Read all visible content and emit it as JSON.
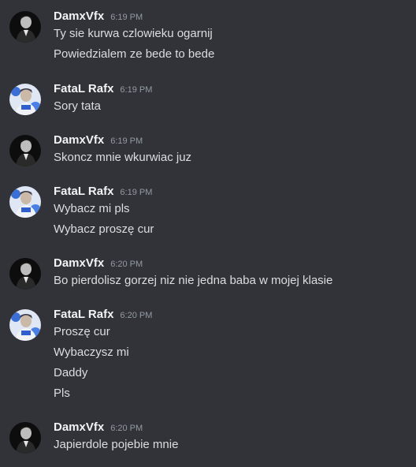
{
  "messages": [
    {
      "username": "DamxVfx",
      "time": "6:19 PM",
      "avatar": "damx-avatar",
      "lines": [
        "Ty sie kurwa czlowieku ogarnij",
        "Powiedzialem ze bede to bede"
      ]
    },
    {
      "username": "FataL Rafx",
      "time": "6:19 PM",
      "avatar": "fatal-avatar",
      "lines": [
        "Sory tata"
      ]
    },
    {
      "username": "DamxVfx",
      "time": "6:19 PM",
      "avatar": "damx-avatar",
      "lines": [
        "Skoncz mnie wkurwiac juz"
      ]
    },
    {
      "username": "FataL Rafx",
      "time": "6:19 PM",
      "avatar": "fatal-avatar",
      "lines": [
        "Wybacz mi pls",
        "Wybacz proszę cur"
      ]
    },
    {
      "username": "DamxVfx",
      "time": "6:20 PM",
      "avatar": "damx-avatar",
      "lines": [
        "Bo pierdolisz gorzej niz nie jedna baba w mojej klasie"
      ]
    },
    {
      "username": "FataL Rafx",
      "time": "6:20 PM",
      "avatar": "fatal-avatar",
      "lines": [
        "Proszę cur",
        "Wybaczysz mi",
        "Daddy",
        "Pls"
      ]
    },
    {
      "username": "DamxVfx",
      "time": "6:20 PM",
      "avatar": "damx-avatar",
      "lines": [
        "Japierdole pojebie mnie"
      ]
    }
  ],
  "colors": {
    "background": "#313338",
    "username": "#f2f3f5",
    "timestamp": "#949ba4",
    "text": "#dbdee1"
  }
}
